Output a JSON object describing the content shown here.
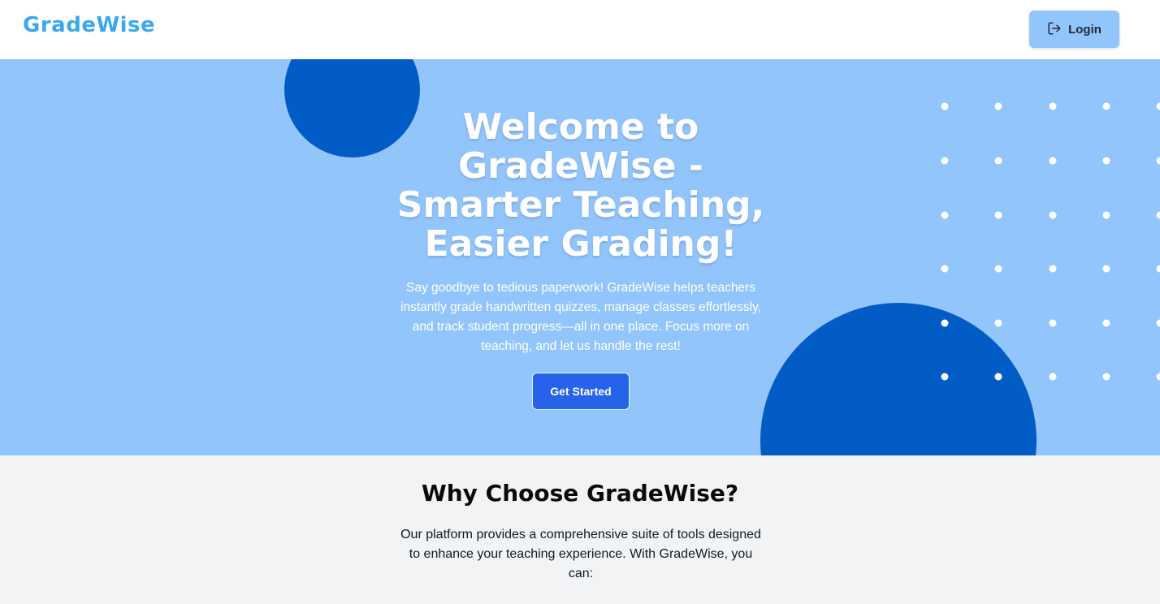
{
  "brand": {
    "name": "GradeWise",
    "color": "#3aa8f0"
  },
  "nav": {
    "login_label": "Login",
    "login_icon": "log-in-icon"
  },
  "hero": {
    "title": "Welcome to GradeWise - Smarter Teaching, Easier Grading!",
    "description": "Say goodbye to tedious paperwork! GradeWise helps teachers instantly grade handwritten quizzes, manage classes effortlessly, and track student progress—all in one place. Focus more on teaching, and let us handle the rest!",
    "cta_label": "Get Started",
    "background_color": "#93c5fd",
    "accent_color": "#025cc6",
    "button_color": "#2563eb"
  },
  "why": {
    "title": "Why Choose GradeWise?",
    "description": "Our platform provides a comprehensive suite of tools designed to enhance your teaching experience. With GradeWise, you can:"
  }
}
